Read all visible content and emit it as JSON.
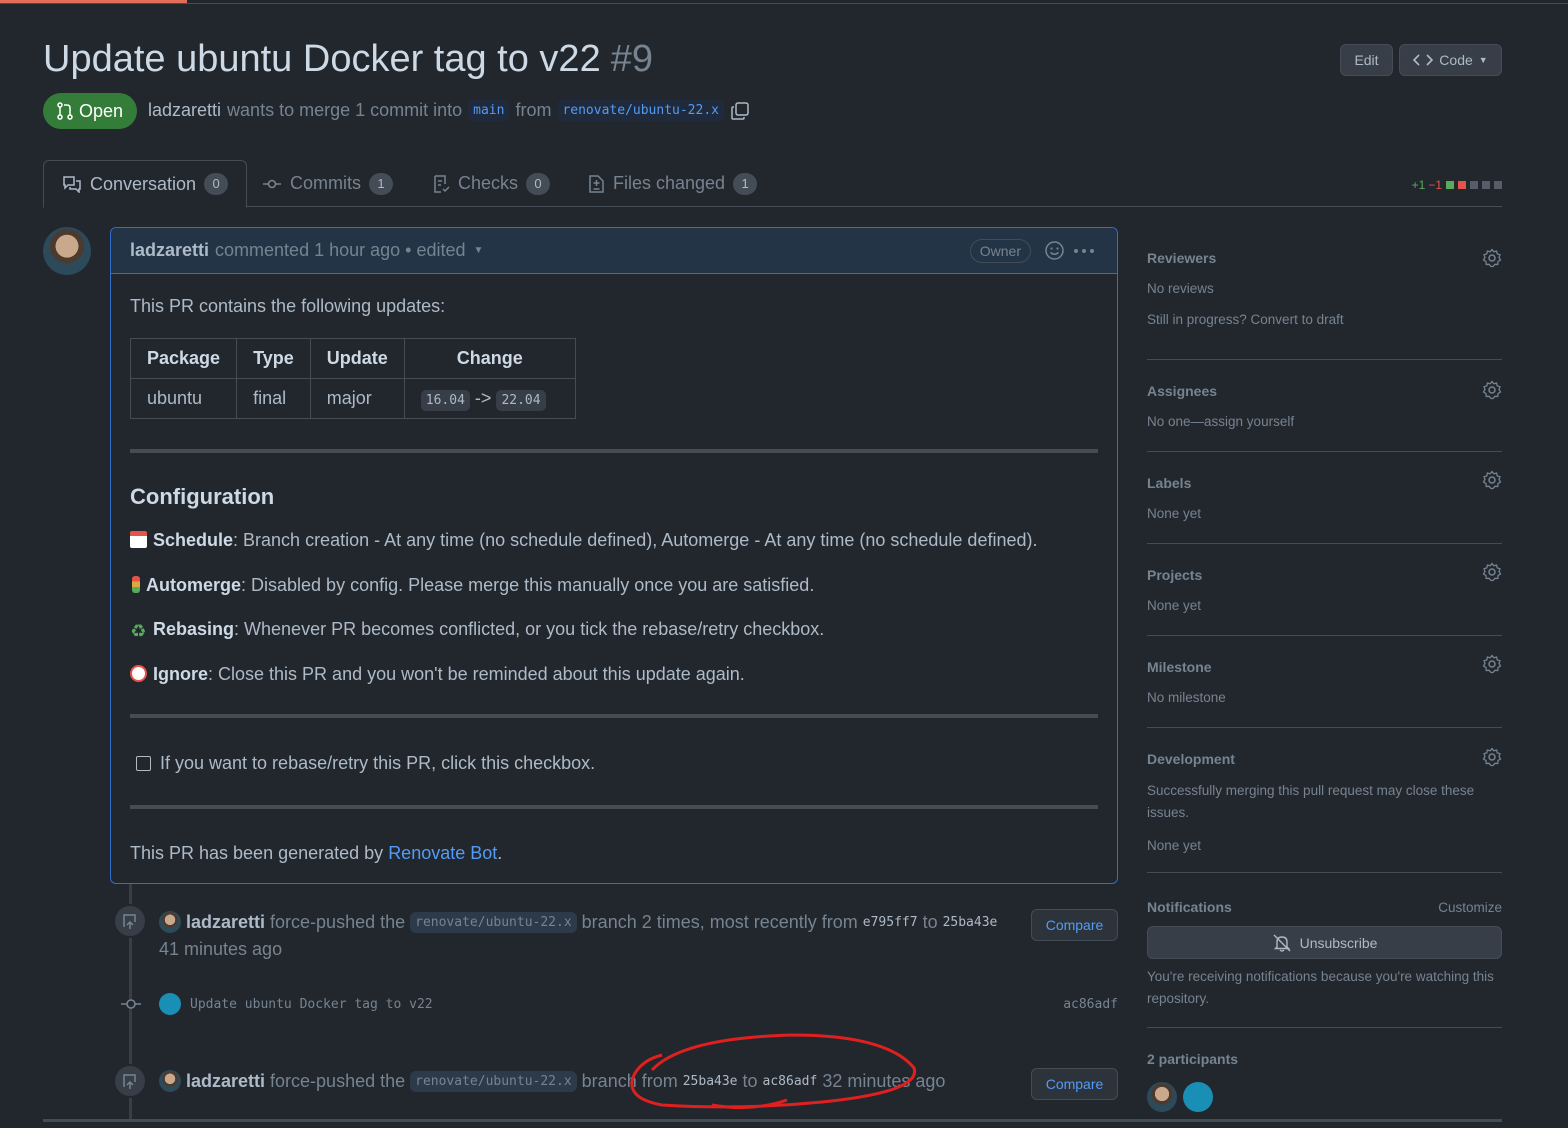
{
  "pr": {
    "title": "Update ubuntu Docker tag to v22",
    "number": "#9",
    "state": "Open",
    "author": "ladzaretti",
    "merge_text": "wants to merge 1 commit into",
    "base": "main",
    "from_text": "from",
    "head": "renovate/ubuntu-22.x"
  },
  "header_buttons": {
    "edit": "Edit",
    "code": "Code"
  },
  "tabs": [
    {
      "label": "Conversation",
      "count": "0"
    },
    {
      "label": "Commits",
      "count": "1"
    },
    {
      "label": "Checks",
      "count": "0"
    },
    {
      "label": "Files changed",
      "count": "1"
    }
  ],
  "diffstat": {
    "additions": "+1",
    "deletions": "−1"
  },
  "comment": {
    "author": "ladzaretti",
    "action": "commented 1 hour ago",
    "edited": "• edited",
    "role": "Owner",
    "intro": "This PR contains the following updates:",
    "table": {
      "headers": [
        "Package",
        "Type",
        "Update",
        "Change"
      ],
      "row": {
        "package": "ubuntu",
        "type": "final",
        "update": "major",
        "from": "16.04",
        "arrow": "->",
        "to": "22.04"
      }
    },
    "config_heading": "Configuration",
    "schedule": {
      "label": "Schedule",
      "text": ": Branch creation - At any time (no schedule defined), Automerge - At any time (no schedule defined)."
    },
    "automerge": {
      "label": "Automerge",
      "text": ": Disabled by config. Please merge this manually once you are satisfied."
    },
    "rebasing": {
      "label": "Rebasing",
      "text": ": Whenever PR becomes conflicted, or you tick the rebase/retry checkbox."
    },
    "ignore": {
      "label": "Ignore",
      "text": ": Close this PR and you won't be reminded about this update again."
    },
    "checkbox": "If you want to rebase/retry this PR, click this checkbox.",
    "footer_prefix": "This PR has been generated by",
    "footer_link": "Renovate Bot",
    "footer_suffix": "."
  },
  "timeline": [
    {
      "user": "ladzaretti",
      "action": "force-pushed the",
      "branch": "renovate/ubuntu-22.x",
      "text": "branch 2 times, most recently from",
      "from": "e795ff7",
      "to_word": "to",
      "to": "25ba43e",
      "time": "41 minutes ago",
      "button": "Compare"
    },
    {
      "message": "Update ubuntu Docker tag to v22",
      "sha": "ac86adf"
    },
    {
      "user": "ladzaretti",
      "action": "force-pushed the",
      "branch": "renovate/ubuntu-22.x",
      "text": "branch from",
      "from": "25ba43e",
      "to_word": "to",
      "to": "ac86adf",
      "time": "32 minutes ago",
      "button": "Compare"
    }
  ],
  "sidebar": {
    "reviewers": {
      "title": "Reviewers",
      "value": "No reviews",
      "extra": "Still in progress? Convert to draft"
    },
    "assignees": {
      "title": "Assignees",
      "value": "No one—assign yourself"
    },
    "labels": {
      "title": "Labels",
      "value": "None yet"
    },
    "projects": {
      "title": "Projects",
      "value": "None yet"
    },
    "milestone": {
      "title": "Milestone",
      "value": "No milestone"
    },
    "development": {
      "title": "Development",
      "text": "Successfully merging this pull request may close these issues.",
      "value": "None yet"
    },
    "notifications": {
      "title": "Notifications",
      "customize": "Customize",
      "button": "Unsubscribe",
      "reason": "You're receiving notifications because you're watching this repository."
    },
    "participants": {
      "title": "2 participants"
    }
  },
  "colors": {
    "accent": "#316dca",
    "open": "#347d39",
    "annotation": "#e0201f",
    "link": "#539bf5"
  }
}
